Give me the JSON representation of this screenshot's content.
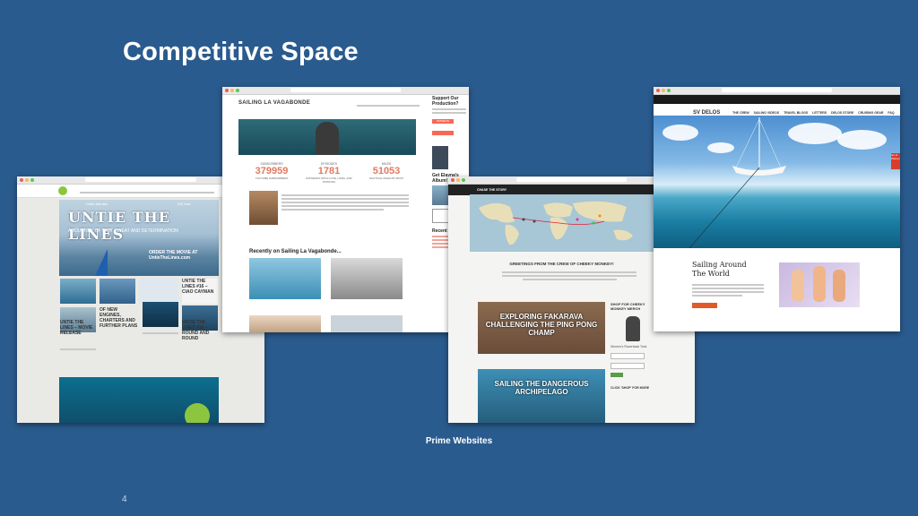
{
  "slide": {
    "title": "Competitive Space",
    "caption": "Prime Websites",
    "page_number": "4"
  },
  "untie_the_lines": {
    "hero_title": "UNTIE THE LINES",
    "hero_subtitle": "A JOURNEY OF SALT SWEAT AND DETERMINATION",
    "hero_cta": "ORDER THE MOVIE AT UntieTheLines.com",
    "hero_left_tag": "Untie Worden",
    "hero_right_tag": "S/V Karl",
    "post_1": "UNTIE THE LINES – MOVIE RELEASE",
    "post_2": "OF NEW ENGINES, CHARTERS AND FURTHER PLANS",
    "post_3": "UNTIE THE LINES #16 – CIAO CAYMAN",
    "post_4": "UNTIE THE LINES #18 – ROUND AND ROUND"
  },
  "la_vagabonde": {
    "logo": "SAILING LA VAGABONDE",
    "stats": [
      {
        "label": "SUBSCRIBERS",
        "value": "379959",
        "sub": "YOUTUBE SUBSCRIBERS"
      },
      {
        "label": "EPISODES",
        "value": "1781",
        "sub": "PATREONS WITH LOVE, LIKES, AND PATRONS"
      },
      {
        "label": "MILES",
        "value": "51053",
        "sub": "NAUTICAL MILES BY BOAT"
      }
    ],
    "recent_heading": "Recently on Sailing La Vagabonde...",
    "sidebar_support": "Support Our Production?",
    "sidebar_patreon": "PATREON",
    "sidebar_album": "Get Elayna's Album!",
    "sidebar_recent": "Recent Posts"
  },
  "cheeky_monkey": {
    "nav_label": "CHASE THE STORY",
    "greeting": "GREETINGS FROM THE CREW OF CHEEKY MONKEY!",
    "post_1": "EXPLORING FAKARAVA CHALLENGING THE PING PONG CHAMP",
    "post_2": "SAILING THE DANGEROUS ARCHIPELAGO",
    "shop_heading": "SHOP FOR CHEEKY MONKEY MERCH",
    "shop_item": "Women's Racerback Tank",
    "shop_footer": "CLICK 'SHOP' FOR MORE"
  },
  "sv_delos": {
    "logo": "SV DELOS",
    "nav_items": [
      "THE CREW",
      "SAILING VIDEOS",
      "TRAVEL BLOGS",
      "LETTERS",
      "DELOS STORE",
      "CRUISING GEAR",
      "FAQ"
    ],
    "heading": "Sailing Around The World",
    "donate_tab": "Go to Patreon"
  },
  "colors": {
    "background": "#2a5b8e",
    "vagabonde_accent": "#e07a5f",
    "delos_button": "#e05a2a"
  }
}
